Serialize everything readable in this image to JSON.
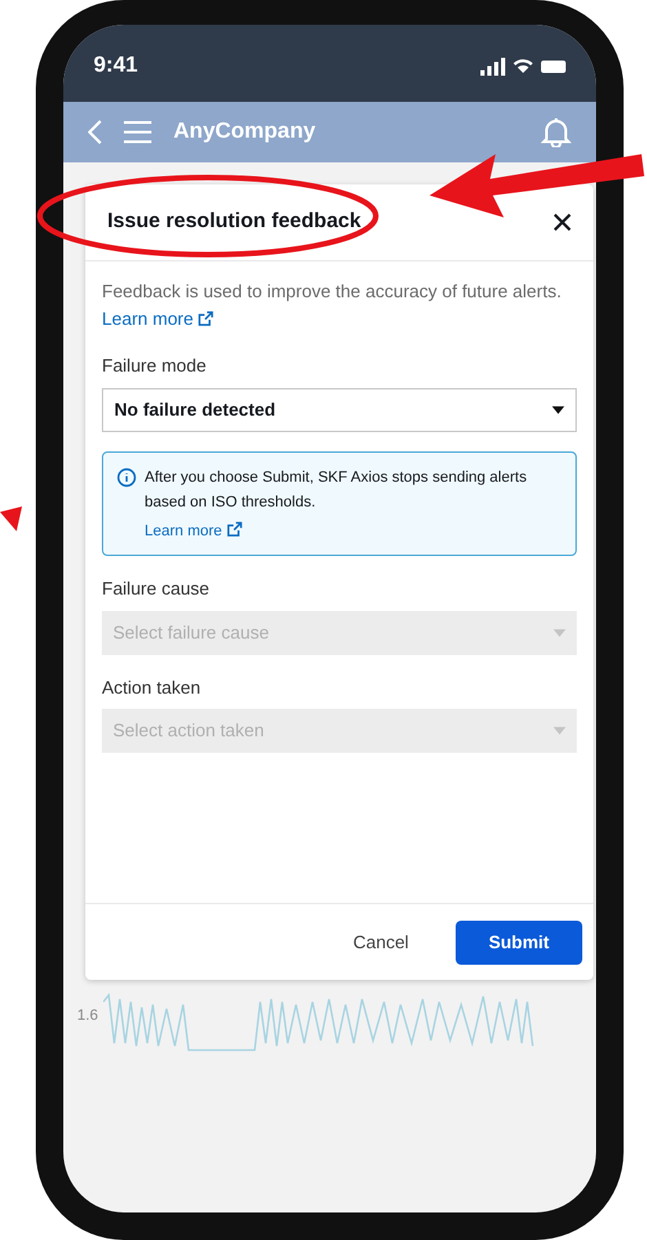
{
  "status_bar": {
    "time": "9:41"
  },
  "app_bar": {
    "title": "AnyCompany"
  },
  "modal": {
    "title": "Issue resolution feedback",
    "intro": "Feedback is used to improve the accuracy of future alerts.",
    "intro_link": "Learn more",
    "fields": [
      {
        "label": "Failure mode",
        "value": "No failure detected",
        "disabled": false
      },
      {
        "label": "Failure cause",
        "placeholder": "Select failure cause",
        "disabled": true
      },
      {
        "label": "Action taken",
        "placeholder": "Select action taken",
        "disabled": true
      }
    ],
    "info": {
      "text": "After you choose Submit, SKF Axios stops sending alerts based on ISO thresholds.",
      "link": "Learn more"
    },
    "buttons": [
      {
        "label": "Cancel",
        "kind": "secondary"
      },
      {
        "label": "Submit",
        "kind": "primary"
      }
    ]
  },
  "background_chart": {
    "axis_label": "1.6"
  }
}
